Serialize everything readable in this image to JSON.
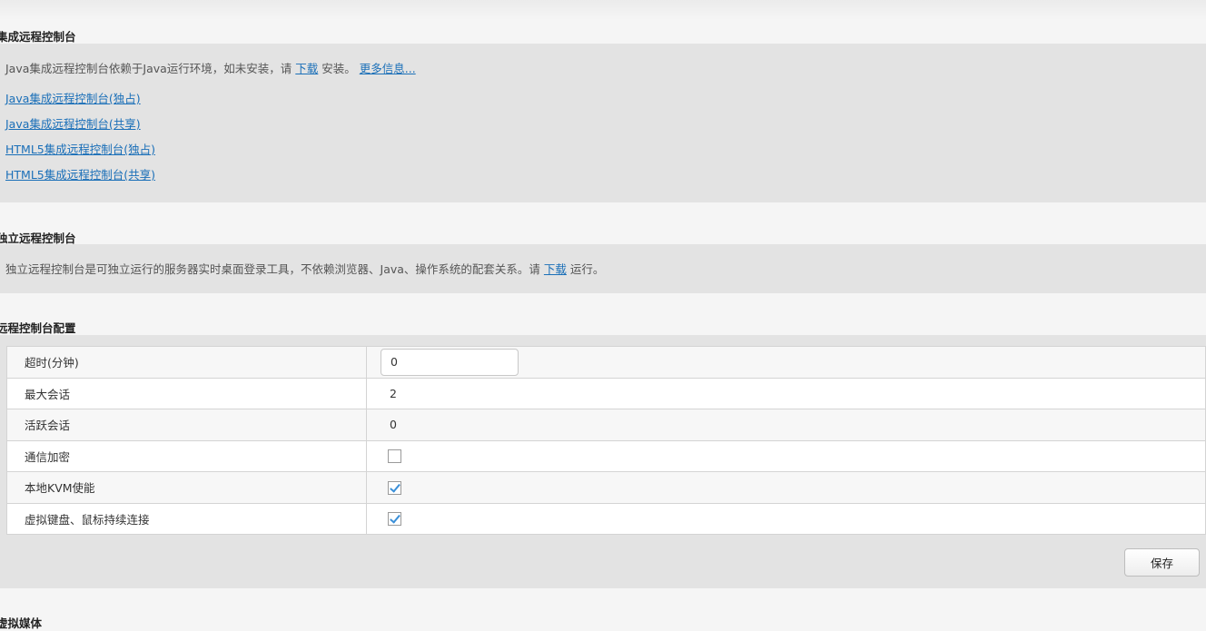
{
  "integrated": {
    "title": "集成远程控制台",
    "desc_prefix": "Java集成远程控制台依赖于Java运行环境，如未安装，请 ",
    "download_link": "下载",
    "desc_mid": " 安装。 ",
    "more_info_link": "更多信息...",
    "links": [
      "Java集成远程控制台(独占)",
      "Java集成远程控制台(共享)",
      "HTML5集成远程控制台(独占)",
      "HTML5集成远程控制台(共享)"
    ]
  },
  "standalone": {
    "title": "独立远程控制台",
    "desc_prefix": "独立远程控制台是可独立运行的服务器实时桌面登录工具，不依赖浏览器、Java、操作系统的配套关系。请 ",
    "download_link": "下载",
    "desc_suffix": " 运行。"
  },
  "config": {
    "title": "远程控制台配置",
    "rows": [
      {
        "label": "超时(分钟)",
        "type": "input",
        "value": "0"
      },
      {
        "label": "最大会话",
        "type": "text",
        "value": "2"
      },
      {
        "label": "活跃会话",
        "type": "text",
        "value": "0"
      },
      {
        "label": "通信加密",
        "type": "checkbox",
        "checked": false
      },
      {
        "label": "本地KVM使能",
        "type": "checkbox",
        "checked": true
      },
      {
        "label": "虚拟键盘、鼠标持续连接",
        "type": "checkbox",
        "checked": true
      }
    ],
    "save_label": "保存"
  },
  "next_section": {
    "title": "虚拟媒体"
  },
  "colors": {
    "link": "#1a6fb8",
    "panel": "#e3e3e3",
    "checkmark": "#3a8fd8"
  }
}
